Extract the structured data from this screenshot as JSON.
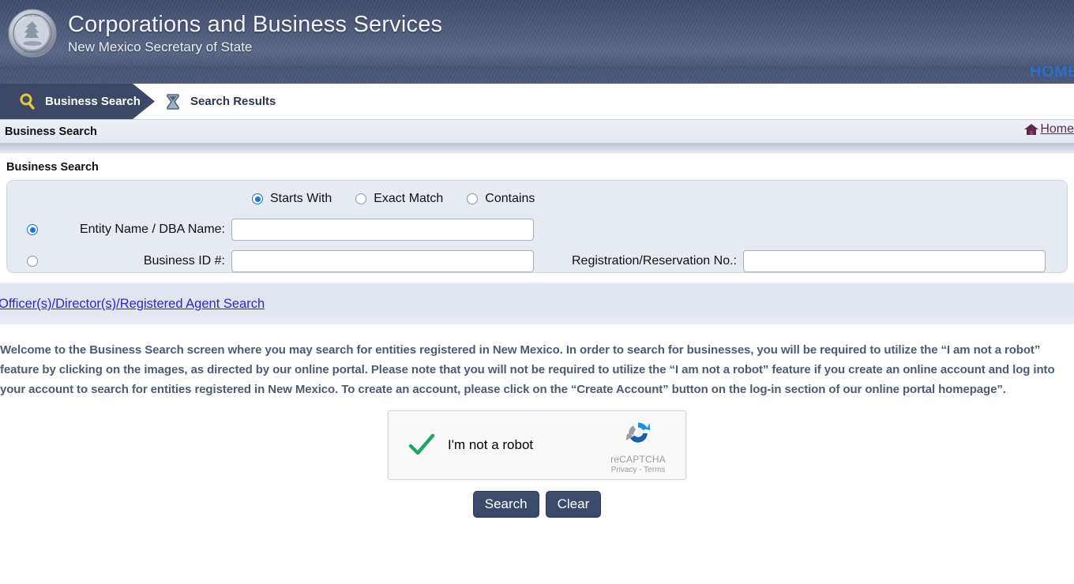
{
  "header": {
    "title": "Corporations and Business Services",
    "subtitle": "New Mexico Secretary of State",
    "seal_icon": "state-seal-icon",
    "home_strip_label": "HOME"
  },
  "tabs": [
    {
      "label": "Business Search",
      "icon": "magnifier-icon",
      "active": true
    },
    {
      "label": "Search Results",
      "icon": "hourglass-icon",
      "active": false
    }
  ],
  "page": {
    "title": "Business Search",
    "home_link_label": "Home",
    "home_link_icon": "house-icon"
  },
  "search": {
    "section_title": "Business Search",
    "match_options": [
      {
        "label": "Starts With",
        "checked": true
      },
      {
        "label": "Exact Match",
        "checked": false
      },
      {
        "label": "Contains",
        "checked": false
      }
    ],
    "fields": [
      {
        "label": "Entity Name / DBA Name:",
        "value": "",
        "placeholder": "",
        "radio_checked": true
      },
      {
        "label": "Business ID #:",
        "value": "",
        "placeholder": "",
        "radio_checked": false
      }
    ],
    "registration": {
      "label": "Registration/Reservation No.:",
      "value": "",
      "placeholder": ""
    },
    "officer_search_link": "Officer(s)/Director(s)/Registered Agent Search"
  },
  "welcome_text": "Welcome to the Business Search screen where you may search for entities registered in New Mexico. In order to search for businesses, you will be required to utilize the “I am not a robot” feature by clicking on the images, as directed by our online portal. Please note that you will not be required to utilize the “I am not a robot” feature if you create an online account and log into your account to search for entities registered in New Mexico. To create an account, please click on the “Create Account” button on the log-in section of our online portal homepage”.",
  "captcha": {
    "label": "I'm not a robot",
    "checked": true,
    "brand": "reCAPTCHA",
    "legal": "Privacy - Terms",
    "logo_icon": "recaptcha-logo-icon",
    "check_icon": "green-check-icon"
  },
  "actions": {
    "search_label": "Search",
    "clear_label": "Clear"
  },
  "colors": {
    "header_navy": "#4a5878",
    "tab_active": "#3c4866",
    "link_blue": "#2727d6",
    "home_link": "#5d2a4e",
    "radio_blue": "#1b75d8",
    "button_navy": "#3f4d6d",
    "welcome_text": "#4d5b74",
    "captcha_check_green": "#1fa463",
    "home_strip_blue": "#2f6fc4"
  }
}
